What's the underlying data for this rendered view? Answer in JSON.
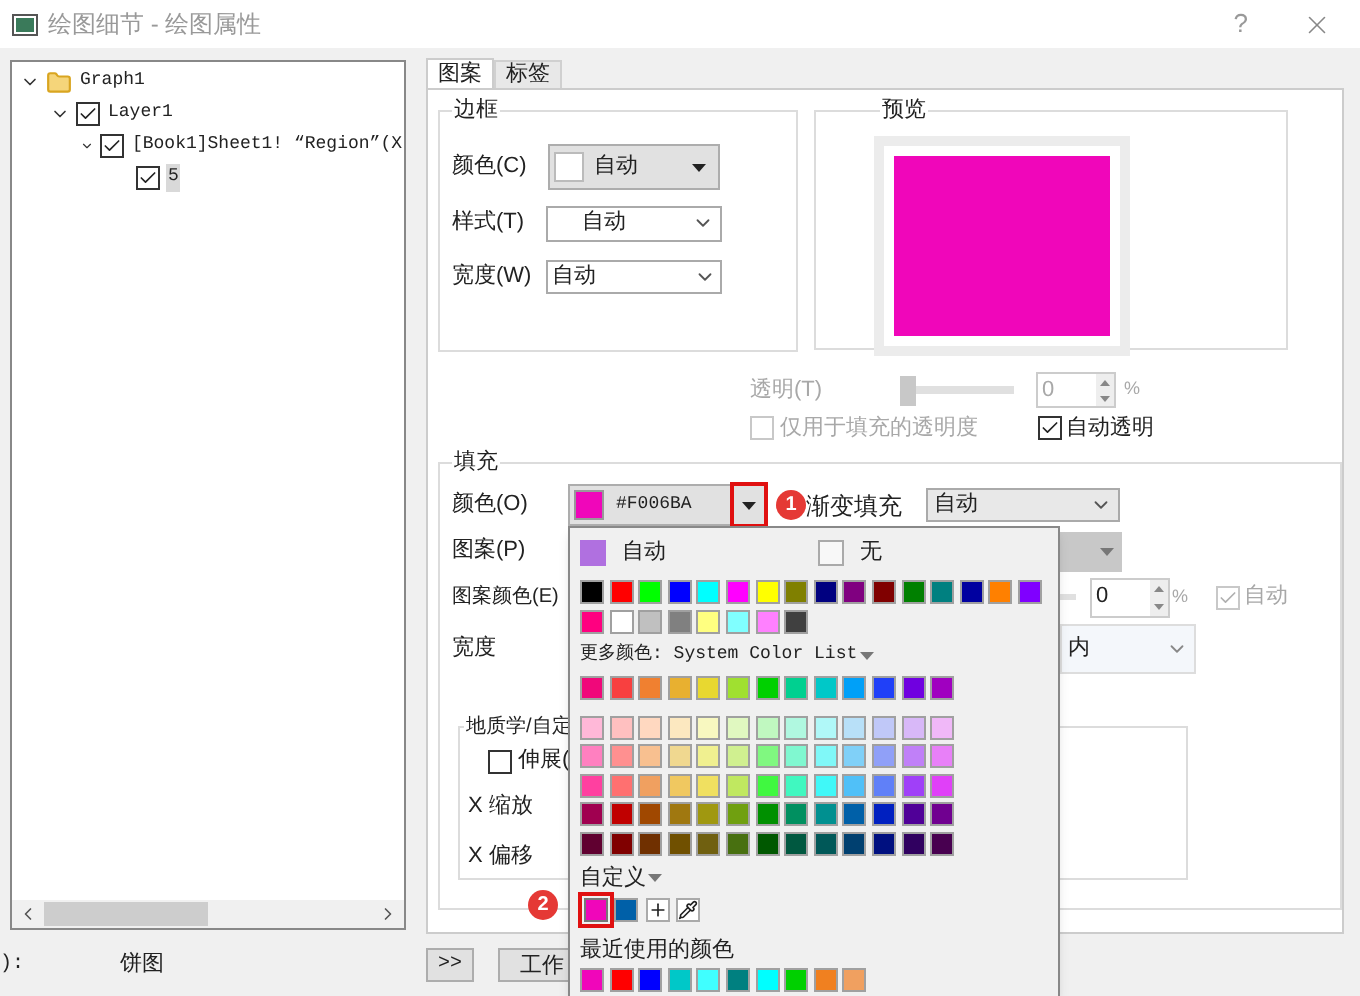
{
  "window": {
    "title": "绘图细节 - 绘图属性",
    "help": "?"
  },
  "tree": [
    {
      "label": "Graph1",
      "kind": "folder",
      "expanded": true,
      "selected": false,
      "children": [
        {
          "label": "Layer1",
          "kind": "check",
          "checked": true,
          "expanded": true,
          "selected": false,
          "children": [
            {
              "label": "[Book1]Sheet1! “Region”(X",
              "kind": "check",
              "checked": true,
              "expanded": true,
              "selected": false,
              "children": [
                {
                  "label": "5",
                  "kind": "check",
                  "checked": true,
                  "selected": true
                }
              ]
            }
          ]
        }
      ]
    }
  ],
  "footer": {
    "label": "):",
    "value": "饼图"
  },
  "bottom_buttons": [
    ">>",
    "工作"
  ],
  "tabs": [
    {
      "label": "图案",
      "selected": true
    },
    {
      "label": "标签",
      "selected": false
    }
  ],
  "border": {
    "title": "边框",
    "color": {
      "label": "颜色(C)",
      "value": "自动"
    },
    "style": {
      "label": "样式(T)",
      "value": "自动"
    },
    "width": {
      "label": "宽度(W)",
      "value": "自动"
    }
  },
  "preview": {
    "title": "预览"
  },
  "transparency": {
    "label": "透明(T)",
    "level": 0,
    "value": "0",
    "unit": "%",
    "disabled": true
  },
  "fill_only": {
    "label": "仅用于填充的透明度",
    "checked": false,
    "disabled": true
  },
  "auto_transparency": {
    "label": "自动透明",
    "checked": true,
    "disabled": false
  },
  "fill": {
    "title": "填充",
    "color": {
      "label": "颜色(O)",
      "value": "#F006BA"
    },
    "gradient": {
      "label": "渐变填充",
      "value": "自动"
    },
    "pattern": {
      "label": "图案(P)"
    },
    "pattern_color": {
      "label": "图案颜色(E)",
      "value": "0",
      "unit": "%",
      "auto_label": "自动",
      "auto_checked": true,
      "auto_disabled": true
    },
    "width": {
      "label": "宽度",
      "value": "内"
    }
  },
  "geology": {
    "title": "地质学/自定",
    "stretch": {
      "label": "伸展(",
      "checked": false
    },
    "x_scale": "X 缩放",
    "x_offset": "X 偏移"
  },
  "color_popup": {
    "auto": {
      "label": "自动",
      "color": "#b070e0"
    },
    "none": {
      "label": "无"
    },
    "basic": [
      {
        "color": "#000000"
      },
      {
        "color": "#ff0000"
      },
      {
        "color": "#00ff00"
      },
      {
        "color": "#0000ff"
      },
      {
        "color": "#00ffff"
      },
      {
        "color": "#ff00ff"
      },
      {
        "color": "#ffff00"
      },
      {
        "color": "#808000"
      },
      {
        "color": "#000080"
      },
      {
        "color": "#800080"
      },
      {
        "color": "#800000"
      },
      {
        "color": "#008000"
      },
      {
        "color": "#008080"
      },
      {
        "color": "#0000a0"
      },
      {
        "color": "#ff8000"
      },
      {
        "color": "#8000ff"
      },
      {
        "color": "#ff0080"
      },
      {
        "color": "#ffffff"
      },
      {
        "color": "#c0c0c0"
      },
      {
        "color": "#808080"
      },
      {
        "color": "#ffff80"
      },
      {
        "color": "#80ffff"
      },
      {
        "color": "#ff80ff"
      },
      {
        "color": "#404040"
      }
    ],
    "more_label": "更多颜色: System Color List",
    "system": [
      {
        "color": "#f0087a"
      },
      {
        "color": "#f84040"
      },
      {
        "color": "#f08030"
      },
      {
        "color": "#e8b030"
      },
      {
        "color": "#e8d830"
      },
      {
        "color": "#a0e030"
      },
      {
        "color": "#00d000"
      },
      {
        "color": "#00d090"
      },
      {
        "color": "#00c8c8"
      },
      {
        "color": "#00a0f8"
      },
      {
        "color": "#2040f8"
      },
      {
        "color": "#7000e0"
      },
      {
        "color": "#a000c0"
      }
    ],
    "shades": [
      {
        "color": "#ffb8d8"
      },
      {
        "color": "#ffc0c0"
      },
      {
        "color": "#ffd8c0"
      },
      {
        "color": "#fce8c0"
      },
      {
        "color": "#f8f8c0"
      },
      {
        "color": "#e0f8c0"
      },
      {
        "color": "#c0f8c0"
      },
      {
        "color": "#b0f8e0"
      },
      {
        "color": "#b0f8f8"
      },
      {
        "color": "#b8e0f8"
      },
      {
        "color": "#c0c8f8"
      },
      {
        "color": "#d8b8f8"
      },
      {
        "color": "#f0b8f8"
      },
      {
        "color": "#ff80c0"
      },
      {
        "color": "#ff9090"
      },
      {
        "color": "#f8c090"
      },
      {
        "color": "#f0d890"
      },
      {
        "color": "#f0f090"
      },
      {
        "color": "#d0f090"
      },
      {
        "color": "#80f880"
      },
      {
        "color": "#80f8d0"
      },
      {
        "color": "#80f8f8"
      },
      {
        "color": "#80d0f8"
      },
      {
        "color": "#90a0f8"
      },
      {
        "color": "#c080f8"
      },
      {
        "color": "#e880f8"
      },
      {
        "color": "#ff40a0"
      },
      {
        "color": "#ff7070"
      },
      {
        "color": "#f0a060"
      },
      {
        "color": "#f0c860"
      },
      {
        "color": "#f0e060"
      },
      {
        "color": "#c0e860"
      },
      {
        "color": "#40f840"
      },
      {
        "color": "#40f8c0"
      },
      {
        "color": "#40f8f8"
      },
      {
        "color": "#50c0f8"
      },
      {
        "color": "#6080f8"
      },
      {
        "color": "#a040f8"
      },
      {
        "color": "#e040f8"
      },
      {
        "color": "#a00050"
      },
      {
        "color": "#c00000"
      },
      {
        "color": "#a04800"
      },
      {
        "color": "#a07810"
      },
      {
        "color": "#a09810"
      },
      {
        "color": "#70a010"
      },
      {
        "color": "#009000"
      },
      {
        "color": "#009060"
      },
      {
        "color": "#009090"
      },
      {
        "color": "#0060a8"
      },
      {
        "color": "#0020c0"
      },
      {
        "color": "#500098"
      },
      {
        "color": "#700090"
      },
      {
        "color": "#600030"
      },
      {
        "color": "#800000"
      },
      {
        "color": "#703000"
      },
      {
        "color": "#705000"
      },
      {
        "color": "#706010"
      },
      {
        "color": "#487010"
      },
      {
        "color": "#005800"
      },
      {
        "color": "#005840"
      },
      {
        "color": "#005858"
      },
      {
        "color": "#004070"
      },
      {
        "color": "#001080"
      },
      {
        "color": "#300060"
      },
      {
        "color": "#480050"
      }
    ],
    "custom_label": "自定义",
    "custom": [
      {
        "color": "#f006ba",
        "selected": true
      },
      {
        "color": "#0060a8",
        "selected": false
      }
    ],
    "recent_label": "最近使用的颜色",
    "recent": [
      {
        "color": "#f006ba"
      },
      {
        "color": "#ff0000"
      },
      {
        "color": "#0000ff"
      },
      {
        "color": "#00c8c8"
      },
      {
        "color": "#40ffff"
      },
      {
        "color": "#008080"
      },
      {
        "color": "#00ffff"
      },
      {
        "color": "#00d000"
      },
      {
        "color": "#f08020"
      },
      {
        "color": "#f0a060"
      }
    ]
  },
  "callouts": [
    {
      "label": "1"
    },
    {
      "label": "2"
    }
  ]
}
